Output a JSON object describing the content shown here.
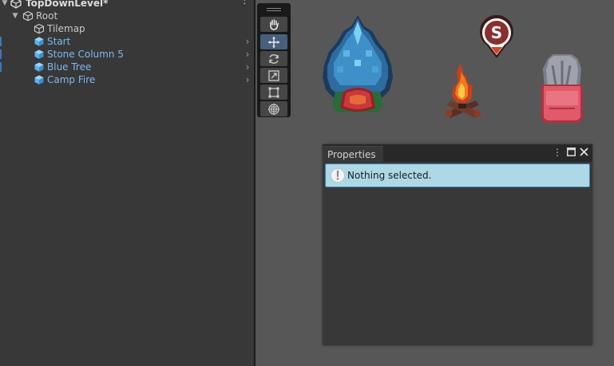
{
  "hierarchy": {
    "scene_name": "TopDownLevel*",
    "items": [
      {
        "label": "Root"
      },
      {
        "label": "Tilemap"
      },
      {
        "label": "Start"
      },
      {
        "label": "Stone Column 5"
      },
      {
        "label": "Blue Tree"
      },
      {
        "label": "Camp Fire"
      }
    ]
  },
  "scene": {
    "tools": [
      "hand-tool",
      "move-tool",
      "rotate-tool",
      "scale-tool",
      "rect-tool",
      "transform-tool"
    ],
    "active_tool": "move-tool",
    "start_marker_letter": "S"
  },
  "properties": {
    "tab_label": "Properties",
    "message": "Nothing selected."
  },
  "colors": {
    "accent": "#46607c",
    "prefab_text": "#7cb8f0",
    "helpbox_bg": "#add8e6"
  }
}
